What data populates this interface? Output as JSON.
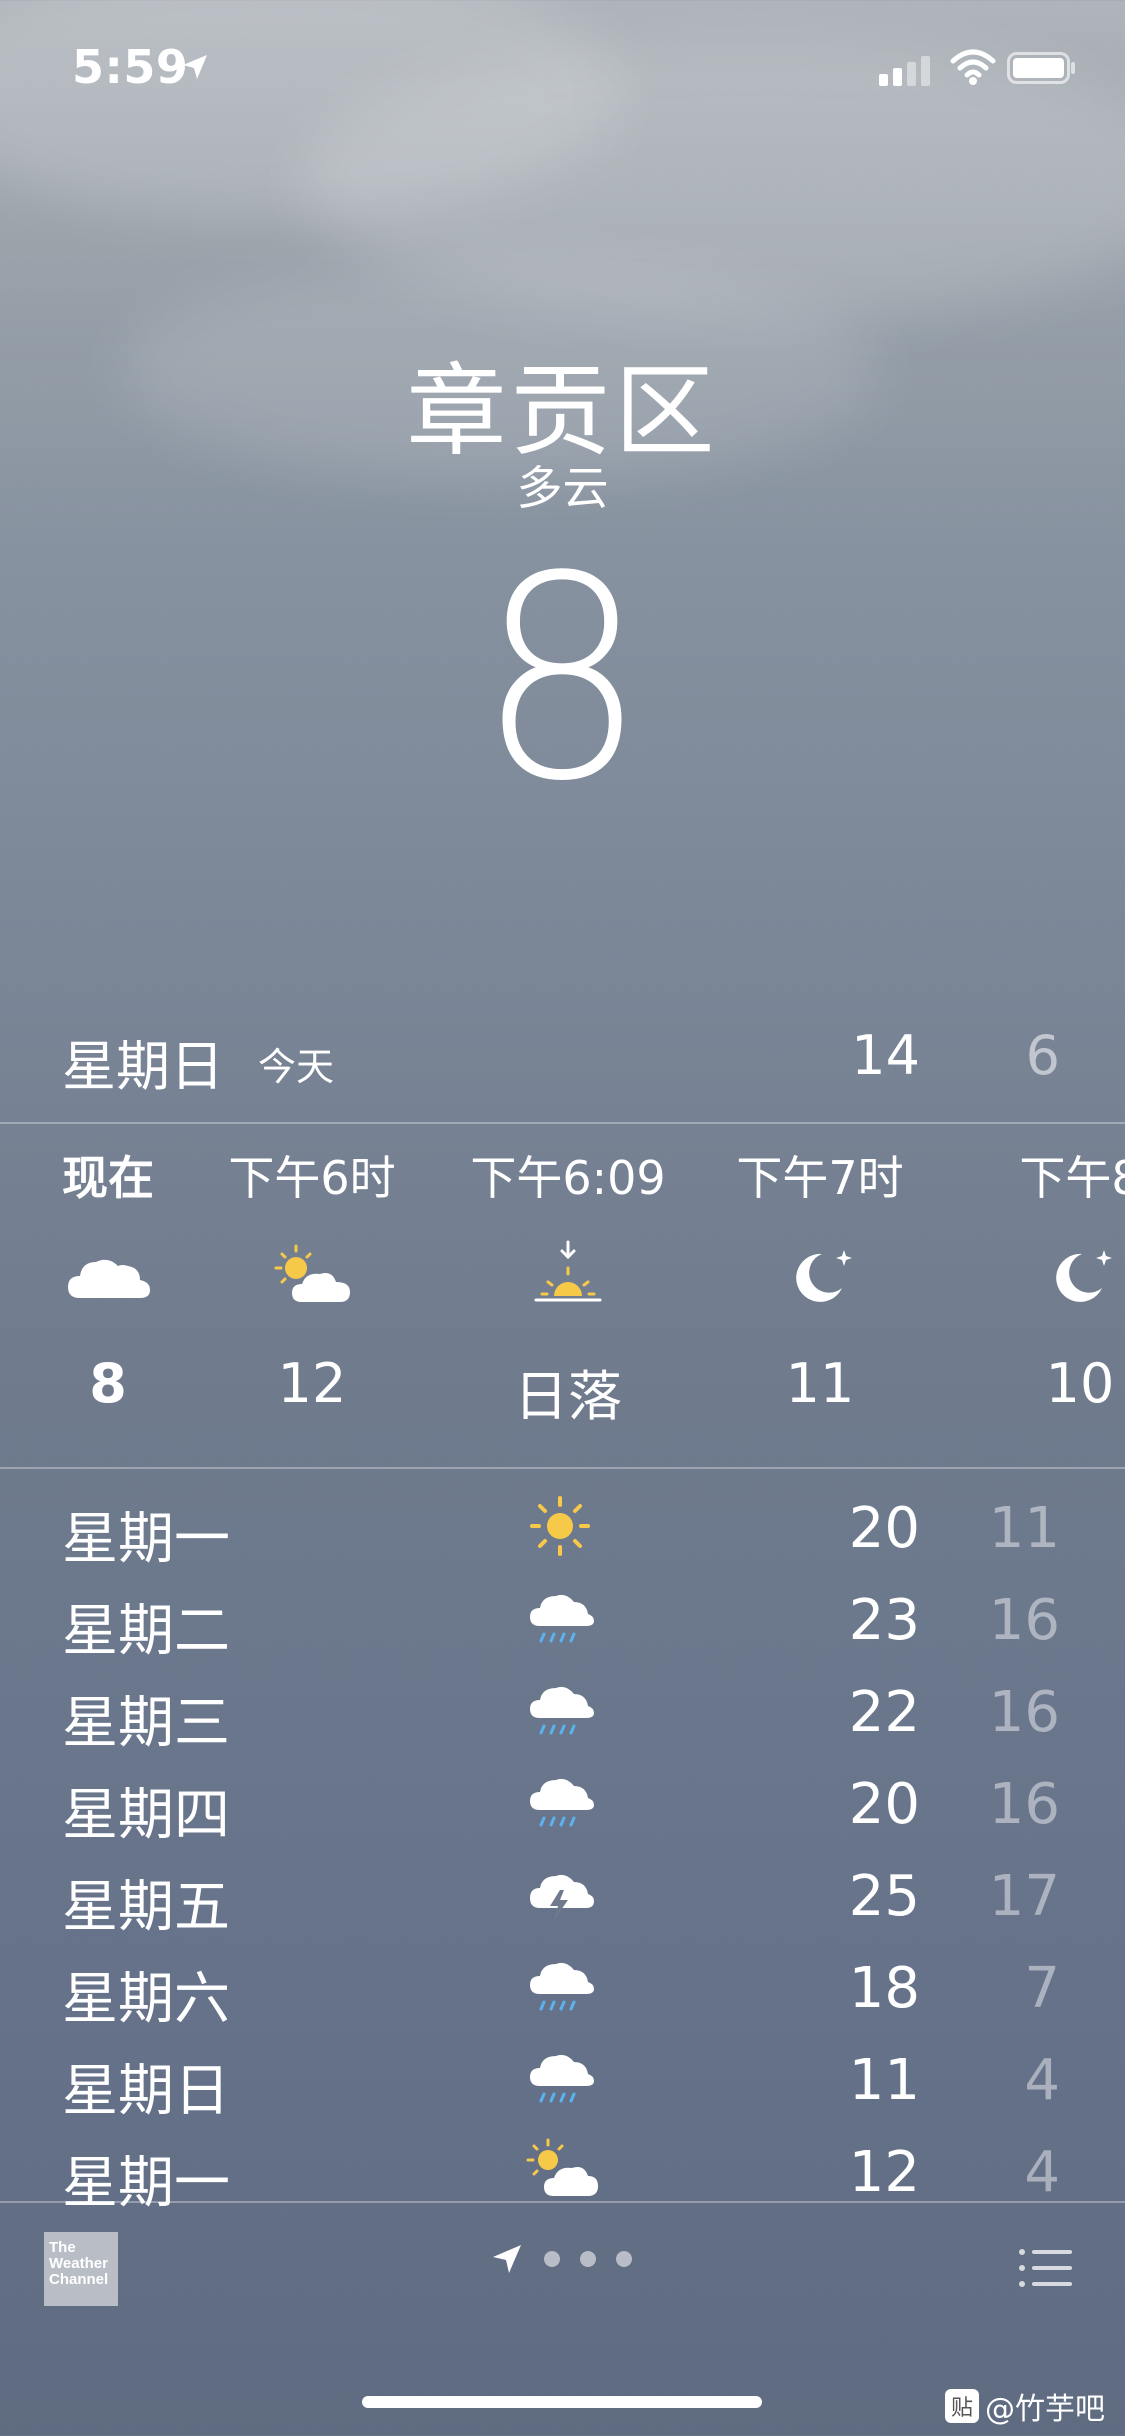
{
  "status_bar": {
    "time": "5:59"
  },
  "header": {
    "city": "章贡区",
    "condition": "多云",
    "temperature": "8"
  },
  "today": {
    "day": "星期日",
    "label": "今天",
    "high": "14",
    "low": "6"
  },
  "hourly": [
    {
      "time": "现在",
      "icon": "cloud-icon",
      "temp": "8"
    },
    {
      "time": "下午6时",
      "icon": "partly-sunny-icon",
      "temp": "12"
    },
    {
      "time": "下午6:09",
      "icon": "sunset-icon",
      "temp": "日落"
    },
    {
      "time": "下午7时",
      "icon": "moon-star-icon",
      "temp": "11"
    },
    {
      "time": "下午8",
      "icon": "moon-star-icon",
      "temp": "10"
    }
  ],
  "daily": [
    {
      "day": "星期一",
      "icon": "sun-icon",
      "high": "20",
      "low": "11"
    },
    {
      "day": "星期二",
      "icon": "rain-icon",
      "high": "23",
      "low": "16"
    },
    {
      "day": "星期三",
      "icon": "rain-icon",
      "high": "22",
      "low": "16"
    },
    {
      "day": "星期四",
      "icon": "rain-icon",
      "high": "20",
      "low": "16"
    },
    {
      "day": "星期五",
      "icon": "thunderstorm-icon",
      "high": "25",
      "low": "17"
    },
    {
      "day": "星期六",
      "icon": "rain-icon",
      "high": "18",
      "low": "7"
    },
    {
      "day": "星期日",
      "icon": "rain-icon",
      "high": "11",
      "low": "4"
    },
    {
      "day": "星期一",
      "icon": "partly-sunny-icon",
      "high": "12",
      "low": "4"
    }
  ],
  "footer": {
    "provider_logo": [
      "The",
      "Weather",
      "Channel"
    ],
    "watermark": "@竹芋吧",
    "watermark_badge": "贴"
  },
  "colors": {
    "sun": "#f7c948",
    "rain": "#5ab3ee",
    "accent_dim": "rgba(255,255,255,0.45)"
  }
}
